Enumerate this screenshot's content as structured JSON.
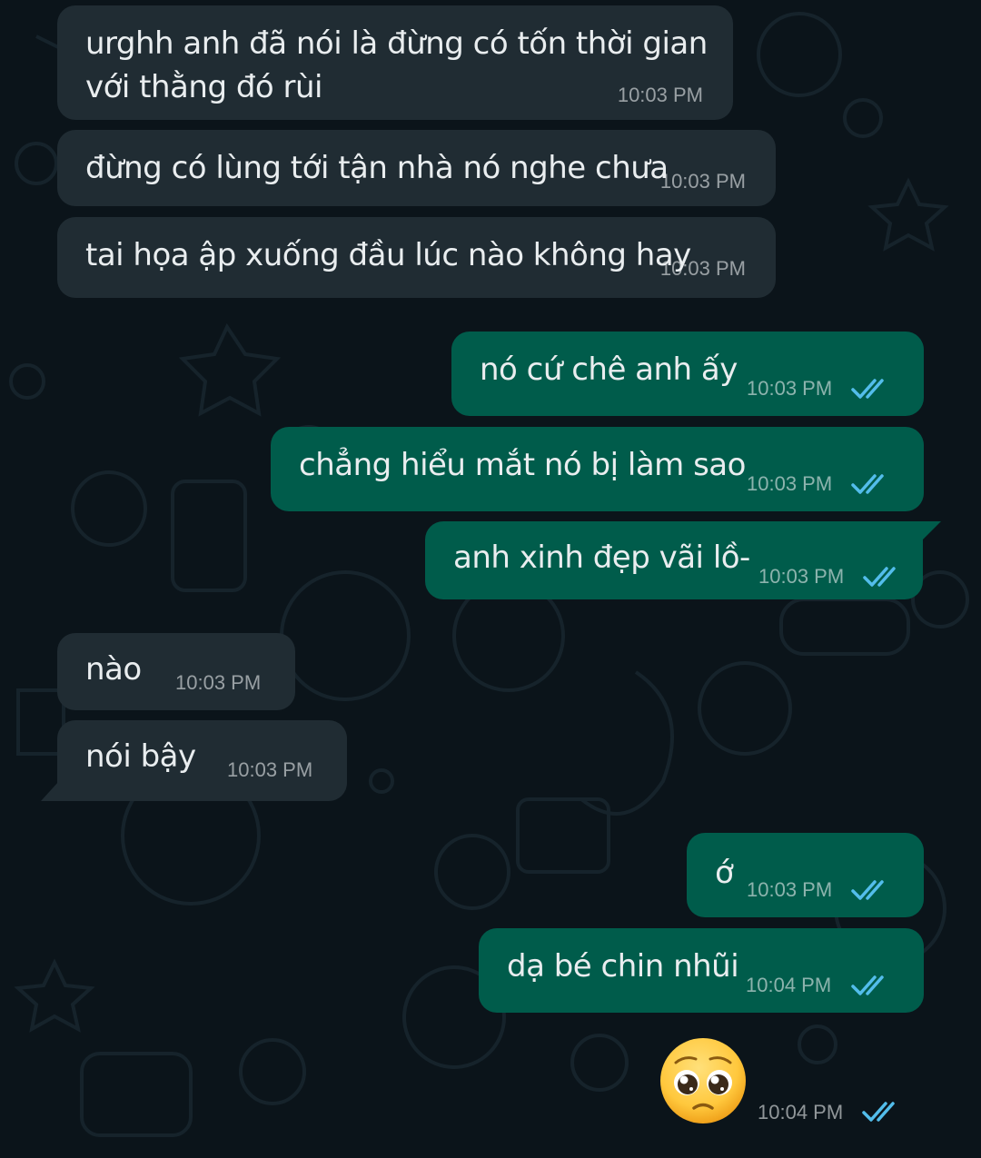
{
  "chat": {
    "messages": [
      {
        "direction": "in",
        "text_lines": [
          "urghh anh đã nói là đừng có tốn thời gian",
          "với thằng đó rùi"
        ],
        "time": "10:03 PM"
      },
      {
        "direction": "in",
        "text": "đừng có lùng tới tận nhà nó nghe chưa",
        "time": "10:03 PM"
      },
      {
        "direction": "in",
        "text": "tai họa ập xuống đầu lúc nào không hay",
        "time": "10:03 PM"
      },
      {
        "direction": "out",
        "text": "nó cứ chê anh ấy",
        "time": "10:03 PM",
        "status": "read"
      },
      {
        "direction": "out",
        "text": "chẳng hiểu mắt nó bị làm sao",
        "time": "10:03 PM",
        "status": "read"
      },
      {
        "direction": "out",
        "text": "anh xinh đẹp vãi lồ-",
        "time": "10:03 PM",
        "status": "read"
      },
      {
        "direction": "in",
        "text": "nào",
        "time": "10:03 PM"
      },
      {
        "direction": "in",
        "text": "nói bậy",
        "time": "10:03 PM"
      },
      {
        "direction": "out",
        "text": "ớ",
        "time": "10:03 PM",
        "status": "read"
      },
      {
        "direction": "out",
        "text": "dạ bé chin nhũi",
        "time": "10:04 PM",
        "status": "read"
      },
      {
        "direction": "out",
        "emoji": "pleading-face-emoji",
        "time": "10:04 PM",
        "status": "read"
      }
    ]
  },
  "colors": {
    "background": "#0b141a",
    "incoming_bubble": "#202c33",
    "outgoing_bubble": "#005c4b",
    "read_ticks": "#53bdeb"
  },
  "icons": {
    "read_receipt": "double-check-icon"
  }
}
